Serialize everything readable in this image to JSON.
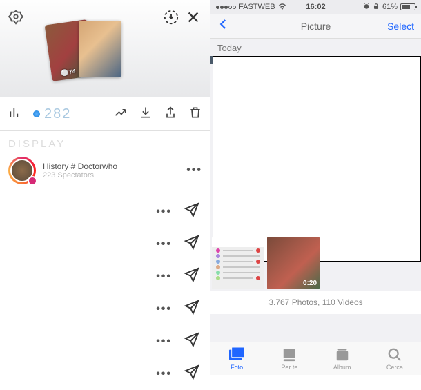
{
  "left": {
    "card_badge": "⚪74",
    "view_count": "282",
    "section_label": "DISPLAY",
    "story": {
      "title": "History # Doctorwho",
      "sub": "223 Spectators"
    }
  },
  "right": {
    "status": {
      "carrier": "FASTWEB",
      "time": "16:02",
      "battery": "61%"
    },
    "nav": {
      "title": "Picture",
      "select": "Select"
    },
    "section": "Today",
    "video_duration": "0:20",
    "counts": "3.767 Photos, 110 Videos",
    "tabs": {
      "foto": "Foto",
      "perte": "Per te",
      "album": "Album",
      "cerca": "Cerca"
    }
  }
}
